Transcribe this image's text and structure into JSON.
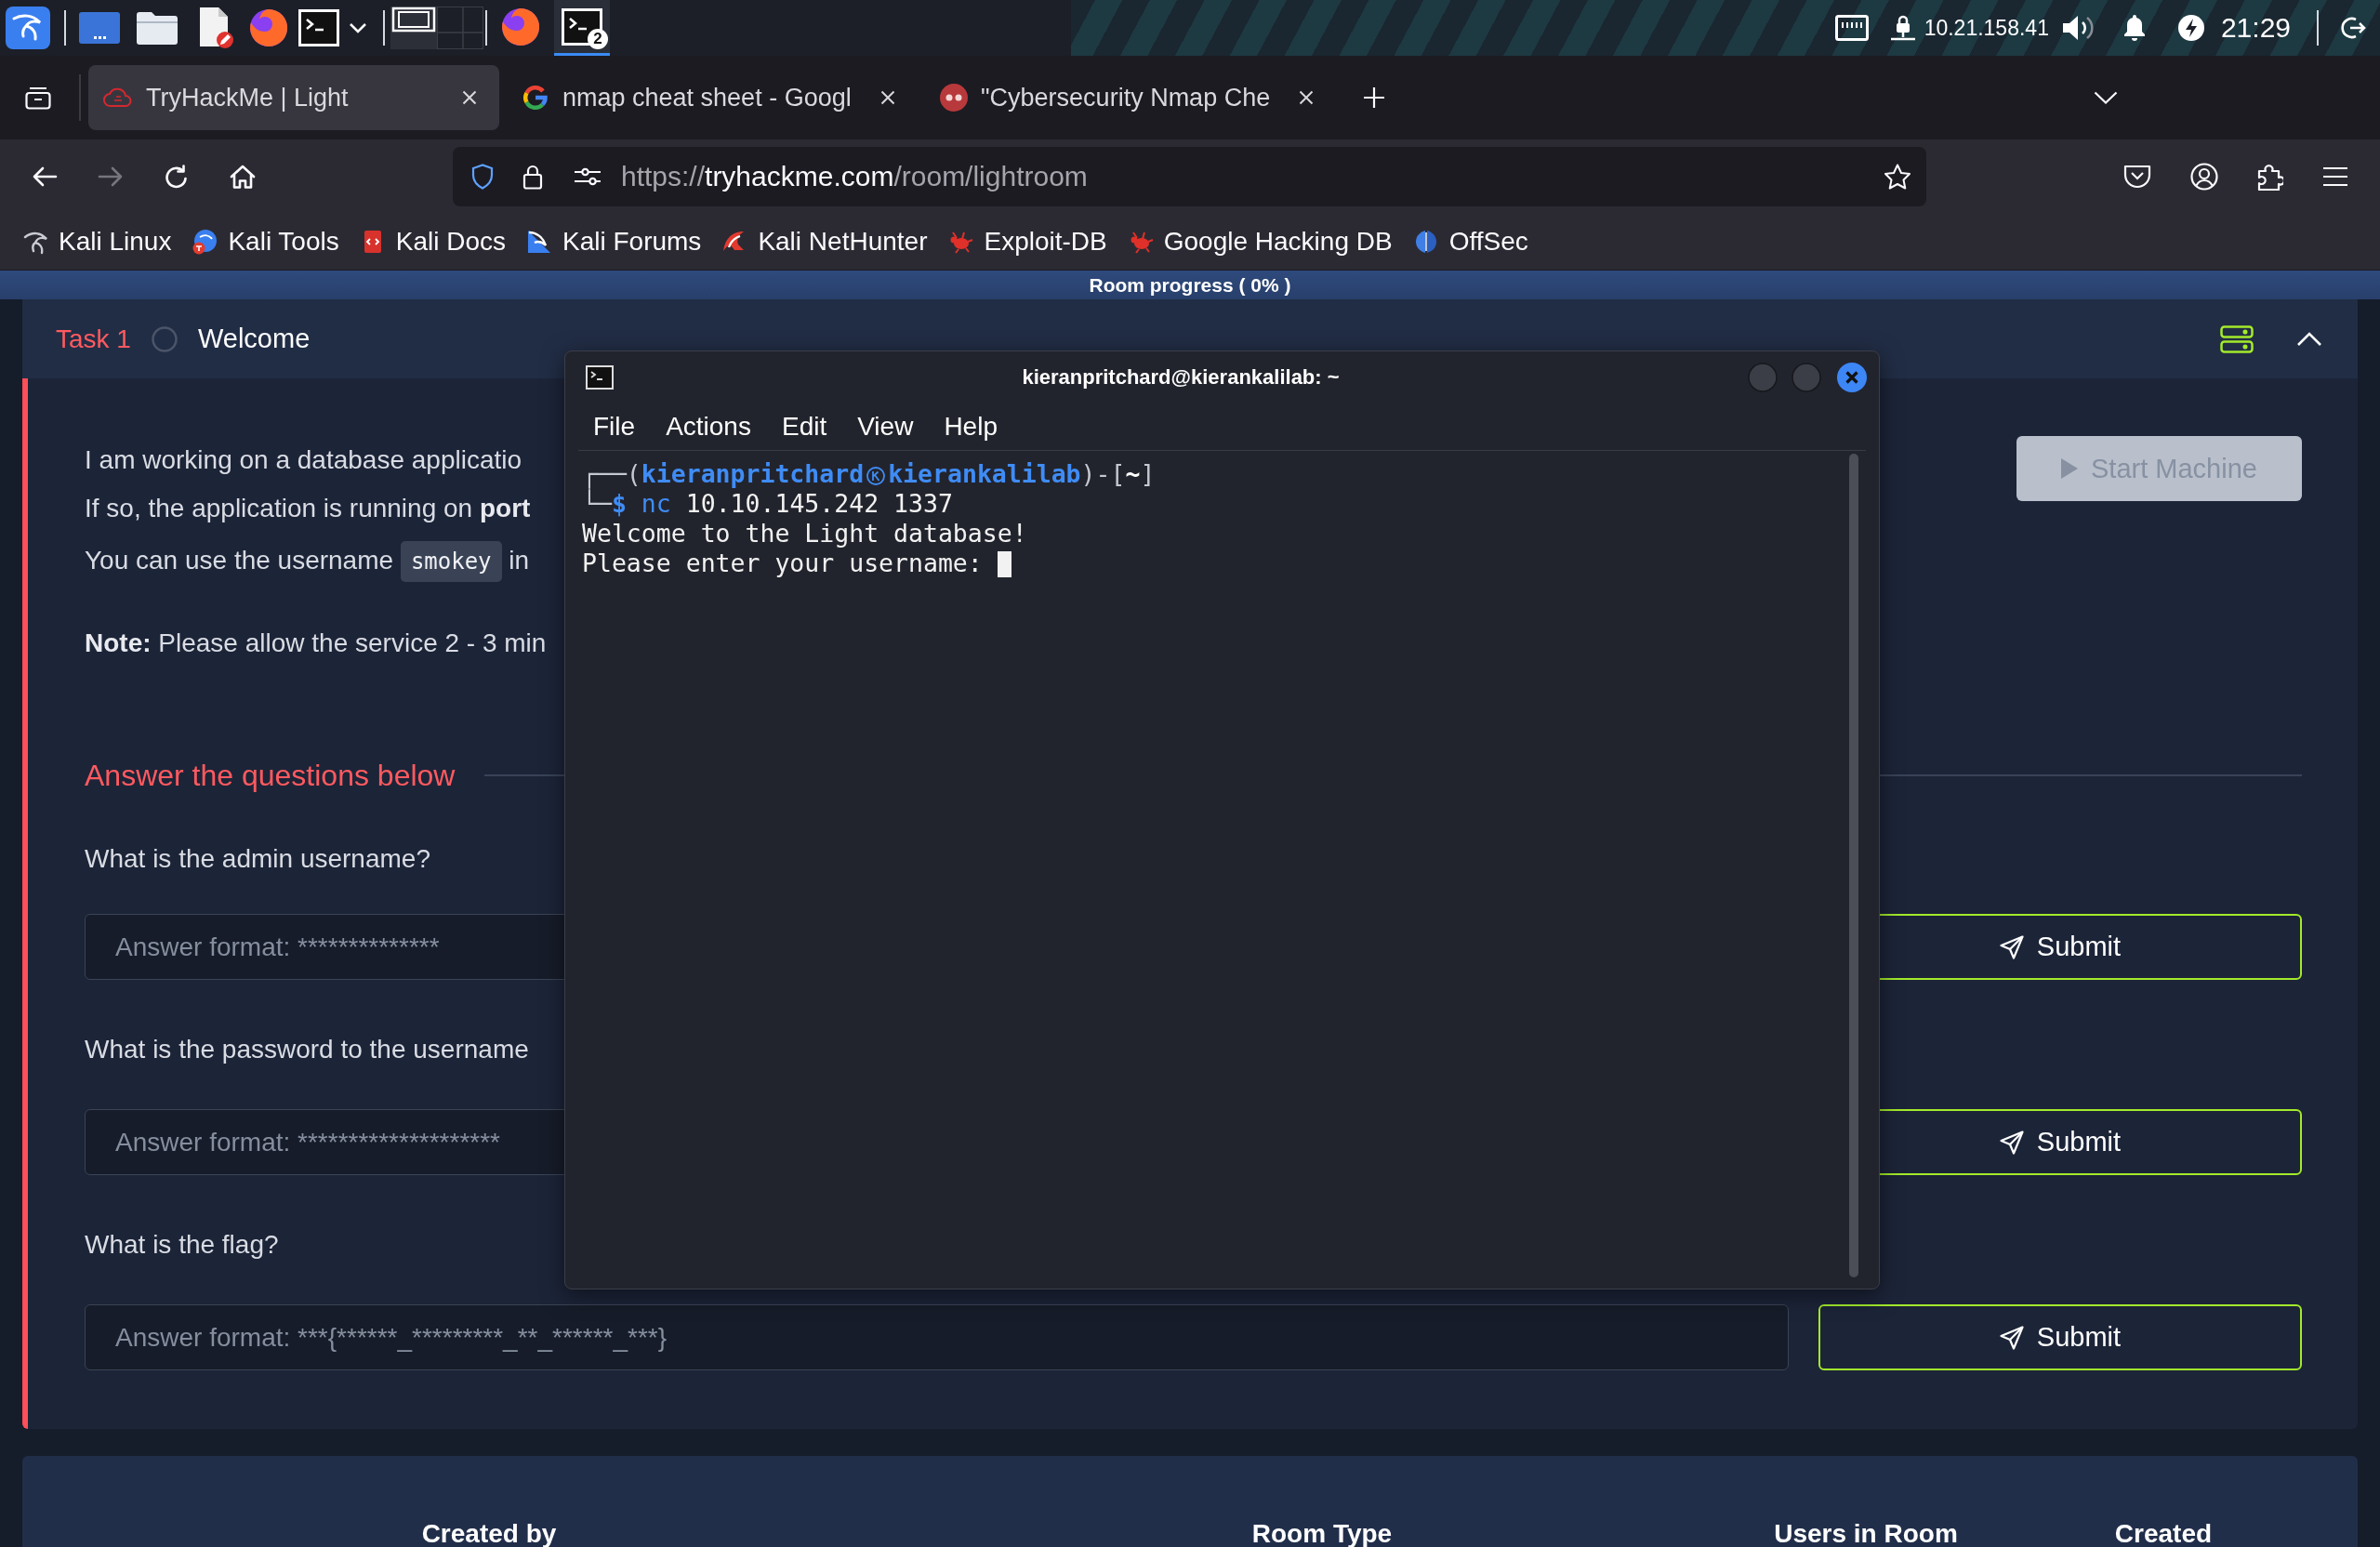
{
  "panel": {
    "windows": [
      {
        "kind": "browser",
        "selected": false
      },
      {
        "kind": "terminal",
        "selected": true,
        "badge": "2"
      }
    ],
    "vpn_address": "10.21.158.41",
    "clock": "21:29"
  },
  "browser": {
    "tabs": [
      {
        "kind": "thm",
        "title": "TryHackMe | Light",
        "selected": true
      },
      {
        "kind": "google",
        "title": "nmap cheat sheet - Googl",
        "selected": false
      },
      {
        "kind": "rb",
        "title": "\"Cybersecurity Nmap Che",
        "selected": false
      }
    ],
    "nav_buttons": [
      {
        "kind": "back",
        "disabled": false
      },
      {
        "kind": "forward",
        "disabled": true
      },
      {
        "kind": "reload",
        "disabled": false
      },
      {
        "kind": "home",
        "disabled": false
      }
    ],
    "address": {
      "scheme": "https://",
      "domain": "tryhackme.com",
      "path": "/room/lightroom"
    },
    "bookmarks": [
      {
        "kind": "dragon",
        "label": "Kali Linux"
      },
      {
        "kind": "tools",
        "label": "Kali Tools"
      },
      {
        "kind": "docs",
        "label": "Kali Docs"
      },
      {
        "kind": "forums",
        "label": "Kali Forums"
      },
      {
        "kind": "nethunter",
        "label": "Kali NetHunter"
      },
      {
        "kind": "bug",
        "label": "Exploit-DB"
      },
      {
        "kind": "bug",
        "label": "Google Hacking DB"
      },
      {
        "kind": "offsec",
        "label": "OffSec"
      }
    ]
  },
  "room_progress": "Room progress ( 0% )",
  "task": {
    "number": "Task 1",
    "title": "Welcome",
    "completed": false,
    "expanded": true,
    "paragraphs": [
      {
        "segments": [
          {
            "kind": "text",
            "text": "I am working on a database applicatio"
          }
        ]
      },
      {
        "segments": [
          {
            "kind": "text",
            "text": "If so, the application is running on **port**"
          }
        ]
      },
      {
        "segments": [
          {
            "kind": "text",
            "text": "You can use the username "
          },
          {
            "kind": "code",
            "text": "smokey"
          },
          {
            "kind": "text",
            "text": " in"
          }
        ]
      },
      {
        "segments": [
          {
            "kind": "text",
            "text": "**Note:** Please allow the service 2 - 3 min"
          }
        ]
      }
    ],
    "start_machine": {
      "label": "Start Machine",
      "disabled": true
    },
    "answers_heading": "Answer the questions below",
    "questions": [
      {
        "question": "What is the admin username?",
        "placeholder": "Answer format: **************",
        "submit": "Submit"
      },
      {
        "question": "What is the password to the username",
        "placeholder": "Answer format: ********************",
        "submit": "Submit"
      },
      {
        "question": "What is the flag?",
        "placeholder": "Answer format: ***{******_*********_**_******_***}",
        "submit": "Submit"
      }
    ]
  },
  "footer": {
    "columns": [
      "Created by",
      "Room Type",
      "Users in Room",
      "Created"
    ]
  },
  "terminal": {
    "title": "kieranpritchard@kierankalilab: ~",
    "menu": [
      "File",
      "Actions",
      "Edit",
      "View",
      "Help"
    ],
    "lines": [
      {
        "cursor": false,
        "segments": [
          {
            "kind": "frame",
            "text": "┌──("
          },
          {
            "kind": "user",
            "text": "kieranpritchard"
          },
          {
            "kind": "host",
            "text": "kierankalilab"
          },
          {
            "kind": "frame",
            "text": ")-["
          },
          {
            "kind": "path",
            "text": "~"
          },
          {
            "kind": "frame",
            "text": "]"
          }
        ]
      },
      {
        "cursor": false,
        "segments": [
          {
            "kind": "frame",
            "text": "└─"
          },
          {
            "kind": "prompt",
            "text": "$ "
          },
          {
            "kind": "command",
            "text": "nc"
          },
          {
            "kind": "text",
            "text": " 10.10.145.242 1337"
          }
        ]
      },
      {
        "cursor": false,
        "segments": [
          {
            "kind": "text",
            "text": "Welcome to the Light database!"
          }
        ]
      },
      {
        "cursor": true,
        "segments": [
          {
            "kind": "text",
            "text": "Please enter your username: "
          }
        ]
      }
    ]
  }
}
